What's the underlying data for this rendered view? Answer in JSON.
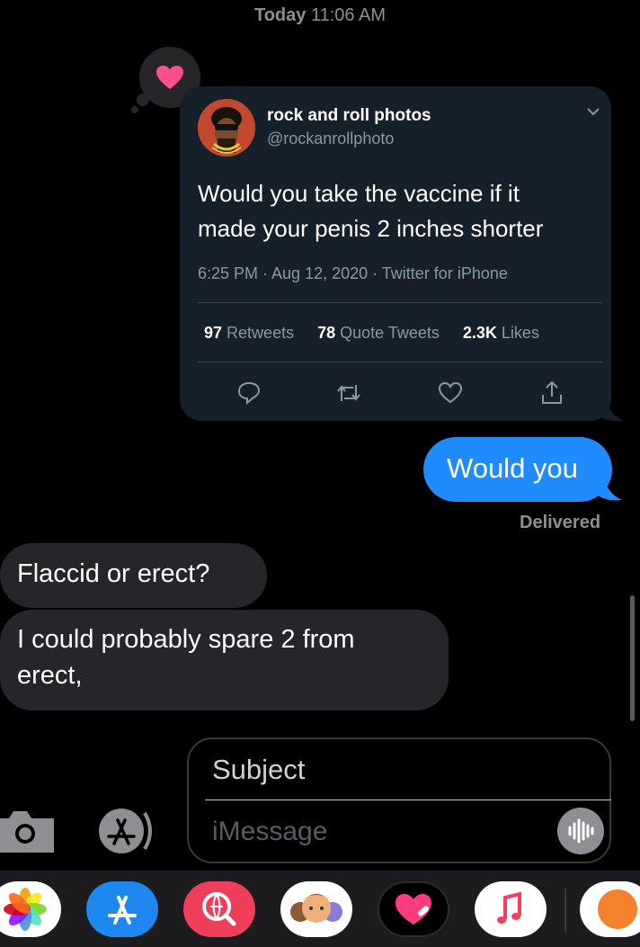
{
  "header": {
    "day": "Today",
    "time": "11:06 AM"
  },
  "tapback": {
    "icon": "heart-icon",
    "color": "#ff4f8b"
  },
  "tweet": {
    "name": "rock and roll photos",
    "handle": "@rockanrollphoto",
    "text_line1": "Would you take the vaccine if it",
    "text_line2": "made your penis 2 inches shorter",
    "meta": "6:25 PM · Aug 12, 2020 · Twitter for iPhone",
    "retweets_count": "97",
    "retweets_label": "Retweets",
    "quotes_count": "78",
    "quotes_label": "Quote Tweets",
    "likes_count": "2.3K",
    "likes_label": "Likes"
  },
  "messages": {
    "outgoing1": "Would you",
    "status": "Delivered",
    "incoming1": "Flaccid or erect?",
    "incoming2_line1": "I could probably spare 2 from",
    "incoming2_line2": "erect,"
  },
  "composer": {
    "subject_placeholder": "Subject",
    "message_placeholder": "iMessage"
  },
  "app_drawer": [
    "photos-icon",
    "app-store-icon",
    "web-search-icon",
    "memoji-icon",
    "digital-touch-icon",
    "music-icon",
    "more-icon"
  ],
  "colors": {
    "outgoing": "#1f8bff",
    "incoming": "#26252a",
    "tweet_bg": "#15202b"
  }
}
